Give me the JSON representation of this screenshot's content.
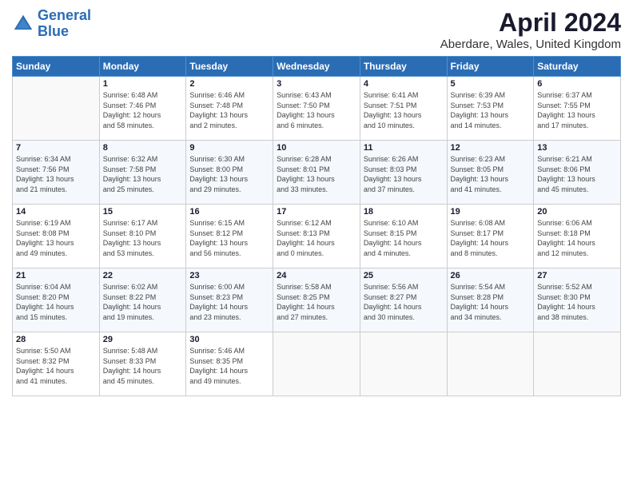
{
  "logo": {
    "line1": "General",
    "line2": "Blue"
  },
  "title": "April 2024",
  "location": "Aberdare, Wales, United Kingdom",
  "days_of_week": [
    "Sunday",
    "Monday",
    "Tuesday",
    "Wednesday",
    "Thursday",
    "Friday",
    "Saturday"
  ],
  "weeks": [
    [
      {
        "day": "",
        "info": ""
      },
      {
        "day": "1",
        "info": "Sunrise: 6:48 AM\nSunset: 7:46 PM\nDaylight: 12 hours\nand 58 minutes."
      },
      {
        "day": "2",
        "info": "Sunrise: 6:46 AM\nSunset: 7:48 PM\nDaylight: 13 hours\nand 2 minutes."
      },
      {
        "day": "3",
        "info": "Sunrise: 6:43 AM\nSunset: 7:50 PM\nDaylight: 13 hours\nand 6 minutes."
      },
      {
        "day": "4",
        "info": "Sunrise: 6:41 AM\nSunset: 7:51 PM\nDaylight: 13 hours\nand 10 minutes."
      },
      {
        "day": "5",
        "info": "Sunrise: 6:39 AM\nSunset: 7:53 PM\nDaylight: 13 hours\nand 14 minutes."
      },
      {
        "day": "6",
        "info": "Sunrise: 6:37 AM\nSunset: 7:55 PM\nDaylight: 13 hours\nand 17 minutes."
      }
    ],
    [
      {
        "day": "7",
        "info": "Sunrise: 6:34 AM\nSunset: 7:56 PM\nDaylight: 13 hours\nand 21 minutes."
      },
      {
        "day": "8",
        "info": "Sunrise: 6:32 AM\nSunset: 7:58 PM\nDaylight: 13 hours\nand 25 minutes."
      },
      {
        "day": "9",
        "info": "Sunrise: 6:30 AM\nSunset: 8:00 PM\nDaylight: 13 hours\nand 29 minutes."
      },
      {
        "day": "10",
        "info": "Sunrise: 6:28 AM\nSunset: 8:01 PM\nDaylight: 13 hours\nand 33 minutes."
      },
      {
        "day": "11",
        "info": "Sunrise: 6:26 AM\nSunset: 8:03 PM\nDaylight: 13 hours\nand 37 minutes."
      },
      {
        "day": "12",
        "info": "Sunrise: 6:23 AM\nSunset: 8:05 PM\nDaylight: 13 hours\nand 41 minutes."
      },
      {
        "day": "13",
        "info": "Sunrise: 6:21 AM\nSunset: 8:06 PM\nDaylight: 13 hours\nand 45 minutes."
      }
    ],
    [
      {
        "day": "14",
        "info": "Sunrise: 6:19 AM\nSunset: 8:08 PM\nDaylight: 13 hours\nand 49 minutes."
      },
      {
        "day": "15",
        "info": "Sunrise: 6:17 AM\nSunset: 8:10 PM\nDaylight: 13 hours\nand 53 minutes."
      },
      {
        "day": "16",
        "info": "Sunrise: 6:15 AM\nSunset: 8:12 PM\nDaylight: 13 hours\nand 56 minutes."
      },
      {
        "day": "17",
        "info": "Sunrise: 6:12 AM\nSunset: 8:13 PM\nDaylight: 14 hours\nand 0 minutes."
      },
      {
        "day": "18",
        "info": "Sunrise: 6:10 AM\nSunset: 8:15 PM\nDaylight: 14 hours\nand 4 minutes."
      },
      {
        "day": "19",
        "info": "Sunrise: 6:08 AM\nSunset: 8:17 PM\nDaylight: 14 hours\nand 8 minutes."
      },
      {
        "day": "20",
        "info": "Sunrise: 6:06 AM\nSunset: 8:18 PM\nDaylight: 14 hours\nand 12 minutes."
      }
    ],
    [
      {
        "day": "21",
        "info": "Sunrise: 6:04 AM\nSunset: 8:20 PM\nDaylight: 14 hours\nand 15 minutes."
      },
      {
        "day": "22",
        "info": "Sunrise: 6:02 AM\nSunset: 8:22 PM\nDaylight: 14 hours\nand 19 minutes."
      },
      {
        "day": "23",
        "info": "Sunrise: 6:00 AM\nSunset: 8:23 PM\nDaylight: 14 hours\nand 23 minutes."
      },
      {
        "day": "24",
        "info": "Sunrise: 5:58 AM\nSunset: 8:25 PM\nDaylight: 14 hours\nand 27 minutes."
      },
      {
        "day": "25",
        "info": "Sunrise: 5:56 AM\nSunset: 8:27 PM\nDaylight: 14 hours\nand 30 minutes."
      },
      {
        "day": "26",
        "info": "Sunrise: 5:54 AM\nSunset: 8:28 PM\nDaylight: 14 hours\nand 34 minutes."
      },
      {
        "day": "27",
        "info": "Sunrise: 5:52 AM\nSunset: 8:30 PM\nDaylight: 14 hours\nand 38 minutes."
      }
    ],
    [
      {
        "day": "28",
        "info": "Sunrise: 5:50 AM\nSunset: 8:32 PM\nDaylight: 14 hours\nand 41 minutes."
      },
      {
        "day": "29",
        "info": "Sunrise: 5:48 AM\nSunset: 8:33 PM\nDaylight: 14 hours\nand 45 minutes."
      },
      {
        "day": "30",
        "info": "Sunrise: 5:46 AM\nSunset: 8:35 PM\nDaylight: 14 hours\nand 49 minutes."
      },
      {
        "day": "",
        "info": ""
      },
      {
        "day": "",
        "info": ""
      },
      {
        "day": "",
        "info": ""
      },
      {
        "day": "",
        "info": ""
      }
    ]
  ]
}
